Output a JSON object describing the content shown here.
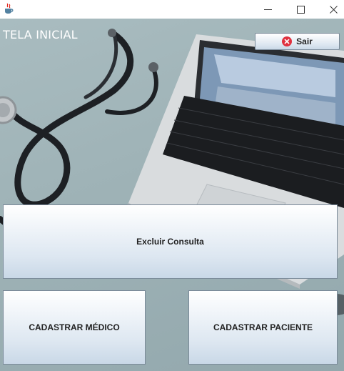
{
  "window": {
    "minimize_glyph": "—",
    "maximize_glyph": "☐",
    "close_glyph": "✕",
    "app_icon": "java-coffee-icon"
  },
  "screen": {
    "title": "TELA INICIAL",
    "background_image": "stethoscope-and-laptop-photo"
  },
  "buttons": {
    "sair": {
      "label": "Sair",
      "icon": "close-circle-icon",
      "icon_color": "#e0313f"
    },
    "excluir_consulta": {
      "label": "Excluir Consulta"
    },
    "cadastrar_medico": {
      "label": "CADASTRAR MÉDICO"
    },
    "cadastrar_paciente": {
      "label": "CADASTRAR PACIENTE"
    }
  }
}
